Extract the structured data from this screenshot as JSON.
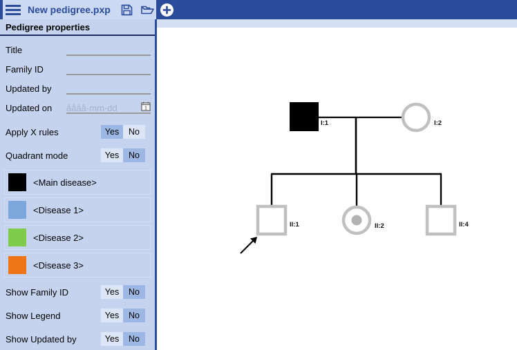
{
  "toolbar": {
    "menu_icon": "hamburger-menu-icon",
    "document_title": "New pedigree.pxp",
    "save_icon": "save-floppy-icon",
    "open_icon": "open-folder-icon",
    "add_icon": "add-plus-circle-icon"
  },
  "sidebar": {
    "header": "Pedigree properties",
    "fields": [
      {
        "label": "Title",
        "value": "",
        "placeholder": ""
      },
      {
        "label": "Family ID",
        "value": "",
        "placeholder": ""
      },
      {
        "label": "Updated by",
        "value": "",
        "placeholder": ""
      },
      {
        "label": "Updated on",
        "value": "",
        "placeholder": "åååå-mm-dd"
      }
    ],
    "toggles_top": [
      {
        "label": "Apply X rules",
        "yes": "Yes",
        "no": "No",
        "selected": "Yes"
      },
      {
        "label": "Quadrant mode",
        "yes": "Yes",
        "no": "No",
        "selected": "No"
      }
    ],
    "diseases": [
      {
        "label": "<Main disease>",
        "color": "#000000"
      },
      {
        "label": "<Disease 1>",
        "color": "#7ba7dd"
      },
      {
        "label": "<Disease 2>",
        "color": "#7fcc4c"
      },
      {
        "label": "<Disease 3>",
        "color": "#ef7415"
      }
    ],
    "toggles_bottom": [
      {
        "label": "Show Family ID",
        "yes": "Yes",
        "no": "No",
        "selected": "No"
      },
      {
        "label": "Show Legend",
        "yes": "Yes",
        "no": "No",
        "selected": "No"
      },
      {
        "label": "Show Updated by",
        "yes": "Yes",
        "no": "No",
        "selected": "No"
      }
    ]
  },
  "pedigree": {
    "individuals": [
      {
        "id": "I:1",
        "shape": "square",
        "fill": "affected",
        "label": "I:1"
      },
      {
        "id": "I:2",
        "shape": "circle",
        "fill": "unaffected",
        "label": "I:2"
      },
      {
        "id": "II:1",
        "shape": "square",
        "fill": "unaffected",
        "label": "II:1",
        "proband": true
      },
      {
        "id": "II:2",
        "shape": "circle",
        "fill": "carrier",
        "label": "II:2"
      },
      {
        "id": "II:4",
        "shape": "square",
        "fill": "unaffected",
        "label": "II:4"
      }
    ],
    "proband_arrow": "proband-arrow-icon",
    "colors": {
      "affected": "#000000",
      "outline": "#c0c0c0",
      "line": "#000000",
      "carrier_dot": "#b3b3b3"
    }
  }
}
